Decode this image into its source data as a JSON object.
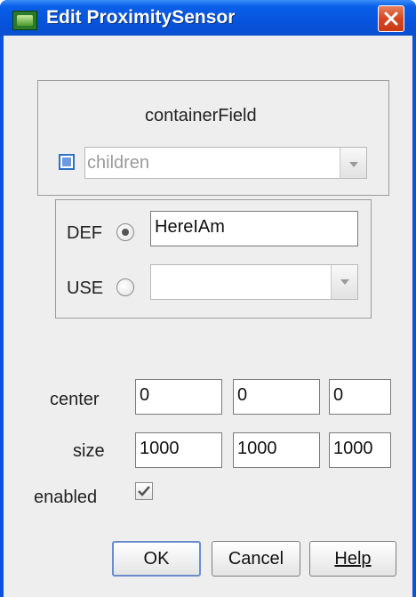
{
  "window": {
    "title": "Edit ProximitySensor"
  },
  "container_field": {
    "heading": "containerField",
    "value": "children",
    "checked": false
  },
  "def_use": {
    "def_label": "DEF",
    "def_selected": true,
    "def_value": "HereIAm",
    "use_label": "USE",
    "use_selected": false,
    "use_value": ""
  },
  "fields": {
    "center": {
      "label": "center",
      "values": [
        "0",
        "0",
        "0"
      ]
    },
    "size": {
      "label": "size",
      "values": [
        "1000",
        "1000",
        "1000"
      ]
    },
    "enabled": {
      "label": "enabled",
      "checked": true
    }
  },
  "buttons": {
    "ok": "OK",
    "cancel": "Cancel",
    "help": "Help"
  },
  "colors": {
    "titlebar": "#0653dd",
    "close": "#d5471f",
    "dialog_bg": "#eeeeee"
  }
}
